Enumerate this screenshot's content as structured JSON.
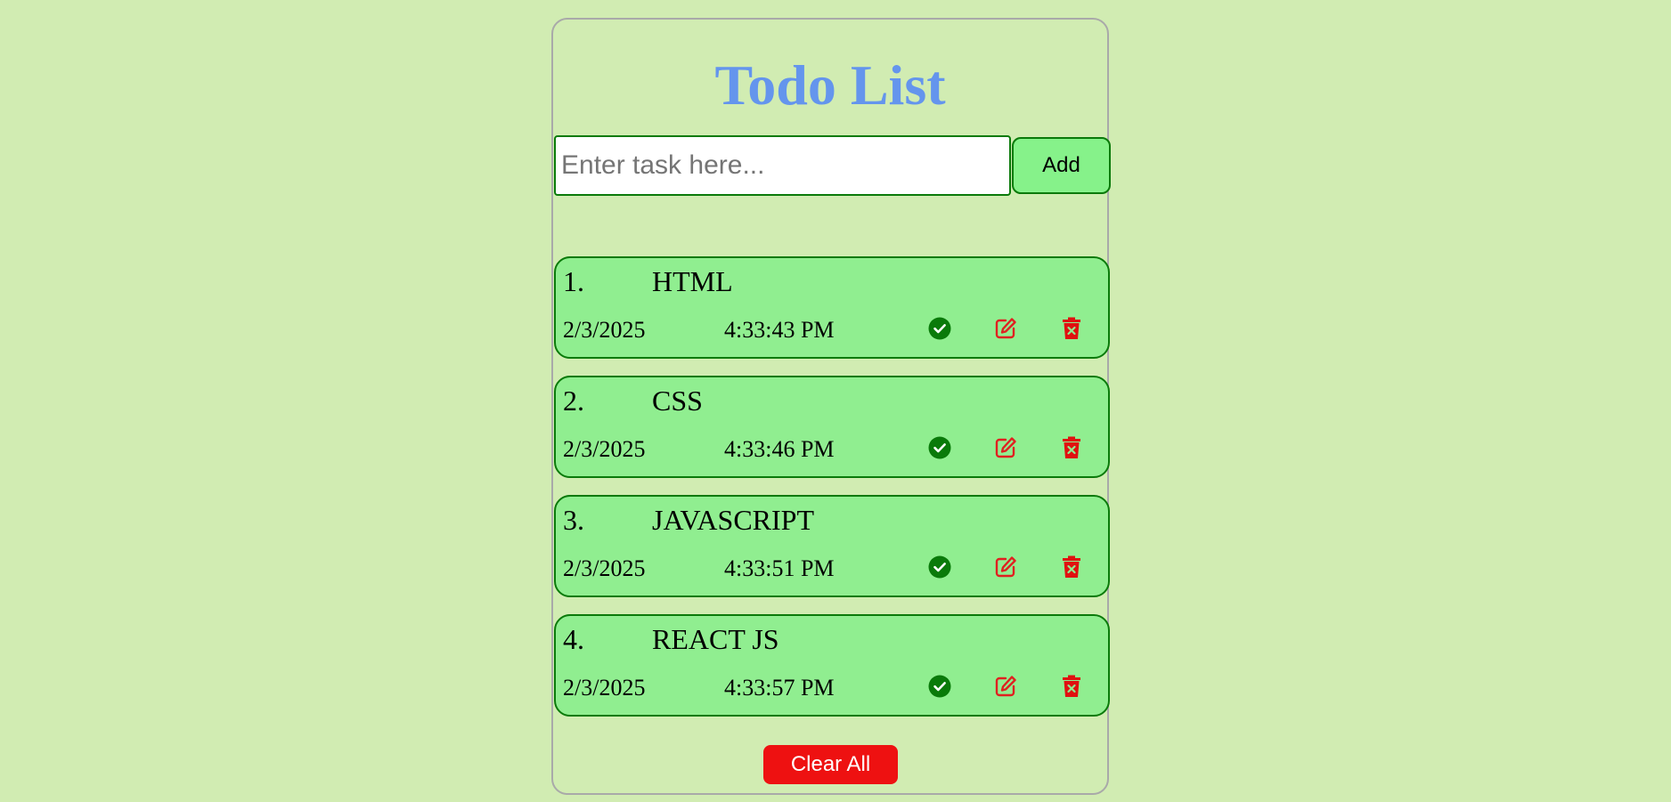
{
  "app": {
    "title": "Todo List"
  },
  "form": {
    "input_placeholder": "Enter task here...",
    "input_value": "",
    "add_label": "Add"
  },
  "todos": [
    {
      "num": "1.",
      "text": "HTML",
      "date": "2/3/2025",
      "time": "4:33:43 PM"
    },
    {
      "num": "2.",
      "text": "CSS",
      "date": "2/3/2025",
      "time": "4:33:46 PM"
    },
    {
      "num": "3.",
      "text": "JAVASCRIPT",
      "date": "2/3/2025",
      "time": "4:33:51 PM"
    },
    {
      "num": "4.",
      "text": "REACT JS",
      "date": "2/3/2025",
      "time": "4:33:57 PM"
    }
  ],
  "icons": {
    "done": "check-circle-icon",
    "edit": "edit-icon",
    "delete": "trash-icon"
  },
  "clear_all_label": "Clear All",
  "colors": {
    "background": "#d1ecb2",
    "title": "#6495ed",
    "item_bg": "#90ee90",
    "item_border": "#0a7a0a",
    "done_icon": "#0a7a0a",
    "edit_icon": "#e02020",
    "delete_icon": "#e01010",
    "clear_btn": "#ee1111",
    "add_btn": "#86f28a"
  }
}
